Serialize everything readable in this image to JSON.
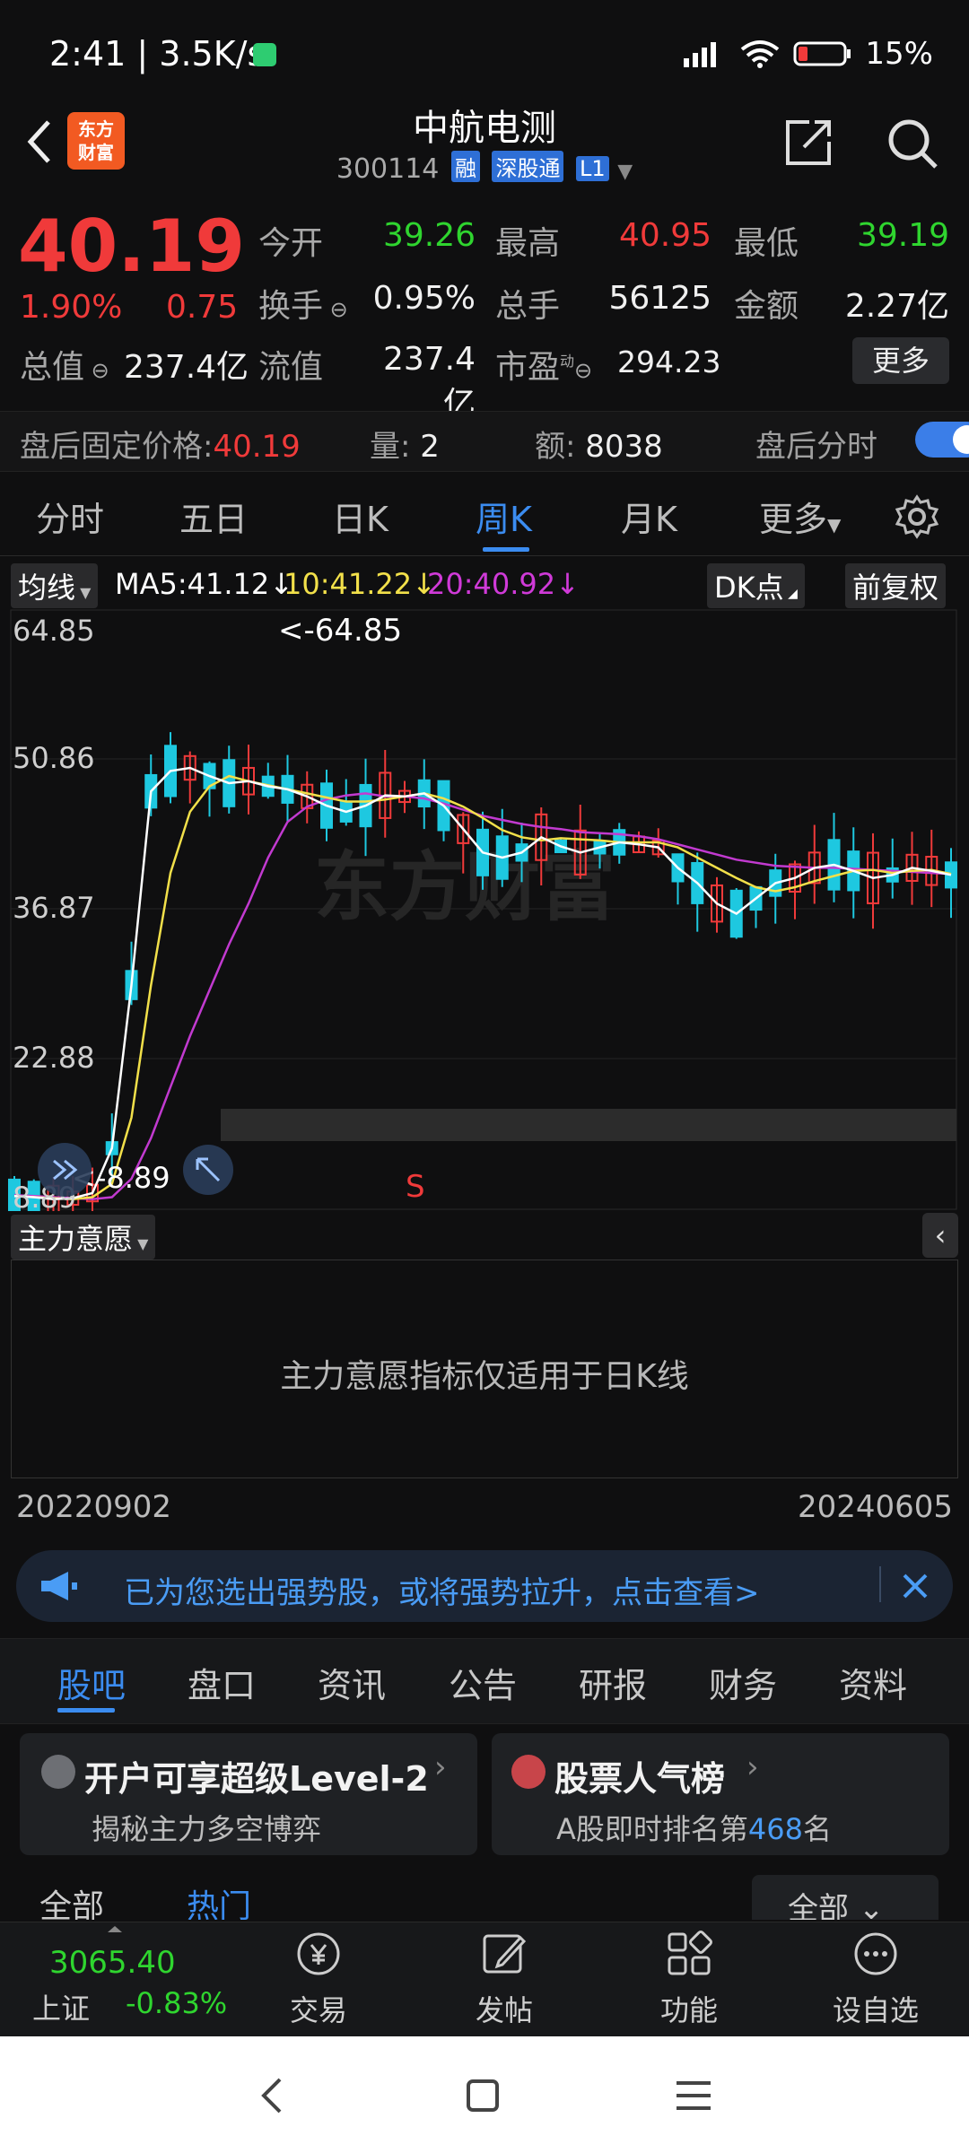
{
  "status": {
    "time": "2:41 | 3.5K/s",
    "battery": "15%"
  },
  "header": {
    "logo_text_1": "东方",
    "logo_text_2": "财富",
    "stock_name": "中航电测",
    "stock_code": "300114",
    "tag_rong": "融",
    "tag_sgt": "深股通",
    "tag_l1": "L1"
  },
  "quote": {
    "price": "40.19",
    "pct": "1.90%",
    "chg": "0.75",
    "open_label": "今开",
    "open": "39.26",
    "high_label": "最高",
    "high": "40.95",
    "low_label": "最低",
    "low": "39.19",
    "turnover_label": "换手",
    "turnover": "0.95%",
    "volume_label": "总手",
    "volume": "56125",
    "amount_label": "金额",
    "amount": "2.27亿",
    "mktcap_label": "总值",
    "mktcap": "237.4亿",
    "float_label": "流值",
    "float": "237.4亿",
    "pe_label": "市盈",
    "pe_sup": "动",
    "pe": "294.23",
    "more": "更多"
  },
  "after_hours": {
    "price_label": "盘后固定价格:",
    "price": "40.19",
    "vol_label": "量:",
    "vol": "2",
    "amt_label": "额:",
    "amt": "8038",
    "timeshare_label": "盘后分时"
  },
  "period_tabs": [
    "分时",
    "五日",
    "日K",
    "周K",
    "月K",
    "更多"
  ],
  "ma_row": {
    "ma_selector": "均线",
    "ma5": "MA5:41.12",
    "ma10": "10:41.22",
    "ma20": "20:40.92",
    "dk": "DK点",
    "adjust": "前复权"
  },
  "chart_data": {
    "type": "candlestick",
    "y_ticks": [
      "64.85",
      "50.86",
      "36.87",
      "22.88",
      "8.89"
    ],
    "high_label": "<-64.85",
    "low_label": "<-8.89",
    "signal_label": "S",
    "watermark": "东方财富",
    "x_start": "20220902",
    "x_end": "20240605",
    "colors": {
      "up": "#f03a3a",
      "down": "#1ec8e0",
      "ma5": "#ffffff",
      "ma10": "#f2e04a",
      "ma20": "#c23ad0"
    },
    "ma5_values": [
      9.3,
      9.2,
      9.0,
      9.1,
      9.6,
      14,
      30,
      49,
      51,
      51.3,
      50.5,
      49.8,
      50.0,
      49.5,
      49.2,
      48.5,
      47.6,
      47.0,
      47.6,
      48.6,
      48.5,
      48.8,
      47.6,
      45.3,
      43.0,
      42.5,
      43.0,
      44.5,
      43.6,
      43.0,
      43.5,
      44.0,
      43.8,
      43.5,
      41.5,
      40.0,
      38.0,
      37.0,
      38.5,
      40.0,
      40.5,
      41.5,
      41.8,
      41.2,
      40.5,
      40.8,
      41.5,
      41.2,
      40.8
    ],
    "ma10_values": [
      9.3,
      9.2,
      9.1,
      9.0,
      9.2,
      10.5,
      17,
      30,
      41,
      47,
      49.5,
      50.5,
      50.0,
      49.6,
      49.2,
      48.8,
      48.4,
      48.0,
      48.0,
      48.2,
      48.5,
      48.8,
      48.3,
      47.5,
      46.4,
      45.2,
      44.5,
      44.2,
      44.4,
      44.3,
      44.2,
      44.0,
      44.0,
      44.0,
      43.5,
      42.5,
      41.5,
      40.5,
      39.6,
      39.2,
      39.6,
      40.2,
      40.7,
      41.2,
      41.3,
      41.0,
      41.2,
      41.3,
      40.9
    ],
    "ma20_values": [
      9.4,
      9.3,
      9.2,
      9.1,
      9.0,
      9.2,
      11,
      15,
      20,
      25,
      29.5,
      34,
      38,
      42.5,
      46,
      47.5,
      48.2,
      48.6,
      48.8,
      48.5,
      48.5,
      48.3,
      47.8,
      47.2,
      46.6,
      46.2,
      45.8,
      45.5,
      45.3,
      45.0,
      44.9,
      44.8,
      44.6,
      44.3,
      43.8,
      43.3,
      42.8,
      42.3,
      42.0,
      41.7,
      41.6,
      41.5,
      41.5,
      41.4,
      41.3,
      41.2,
      41.1,
      41.0,
      40.9
    ]
  },
  "indicator": {
    "selector": "主力意愿",
    "message": "主力意愿指标仅适用于日K线"
  },
  "banner": {
    "text": "已为您选出强势股，或将强势拉升，点击查看>"
  },
  "content_tabs": [
    "股吧",
    "盘口",
    "资讯",
    "公告",
    "研报",
    "财务",
    "资料"
  ],
  "cards": [
    {
      "title": "开户可享超级Level-2",
      "sub": "揭秘主力多空博弈"
    },
    {
      "title": "股票人气榜",
      "sub_pre": "A股即时排名第",
      "sub_rank": "468",
      "sub_post": "名"
    }
  ],
  "filters": {
    "all": "全部",
    "hot": "热门",
    "all_dd": "全部"
  },
  "bottom_nav": {
    "index_value": "3065.40",
    "index_name": "上证",
    "index_pct": "-0.83%",
    "trade": "交易",
    "post": "发帖",
    "func": "功能",
    "watch": "设自选"
  }
}
